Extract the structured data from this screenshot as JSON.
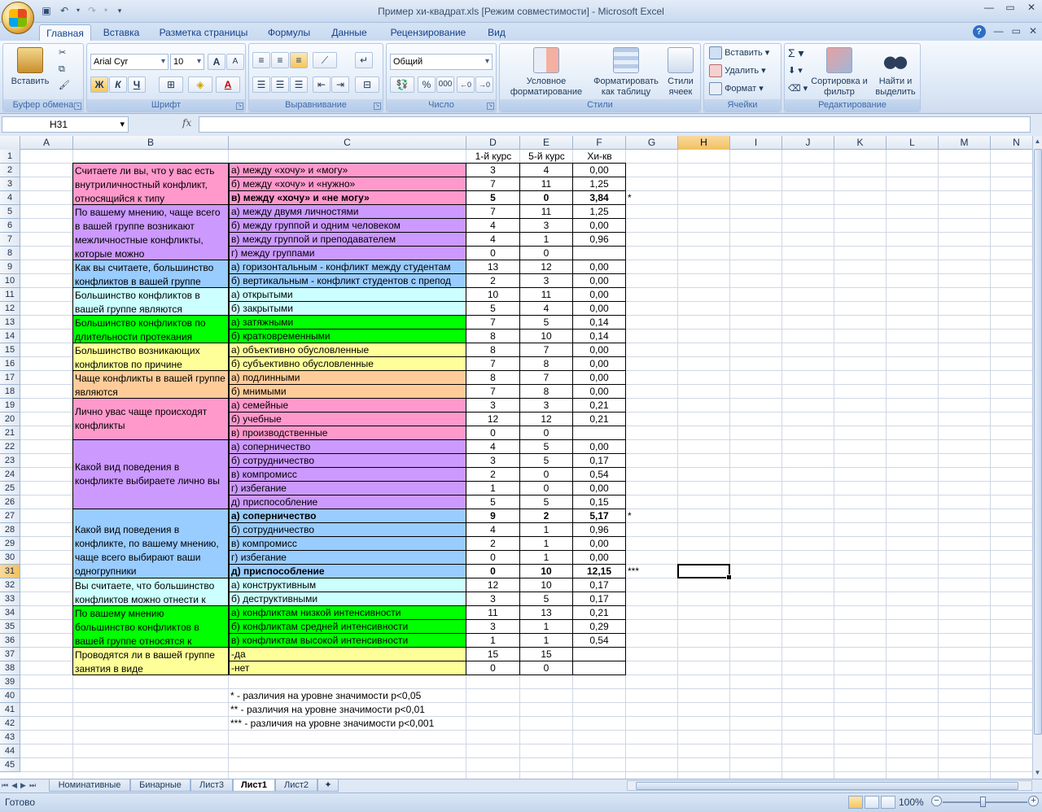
{
  "window": {
    "title": "Пример хи-квадрат.xls  [Режим совместимости] - Microsoft Excel"
  },
  "ribbon": {
    "tabs": [
      "Главная",
      "Вставка",
      "Разметка страницы",
      "Формулы",
      "Данные",
      "Рецензирование",
      "Вид"
    ],
    "active_tab": "Главная",
    "clipboard": {
      "label": "Буфер обмена",
      "paste": "Вставить"
    },
    "font": {
      "label": "Шрифт",
      "font_name": "Arial Cyr",
      "font_size": "10",
      "bold": "Ж",
      "italic": "К",
      "underline": "Ч",
      "grow": "A",
      "shrink": "A",
      "color": "A"
    },
    "alignment": {
      "label": "Выравнивание"
    },
    "number": {
      "label": "Число",
      "format": "Общий",
      "percent": "%",
      "thousands": "000"
    },
    "styles": {
      "label": "Стили",
      "conditional": "Условное форматирование",
      "as_table": "Форматировать как таблицу",
      "cell_styles": "Стили ячеек"
    },
    "cells": {
      "label": "Ячейки",
      "insert": "Вставить",
      "delete": "Удалить",
      "format": "Формат"
    },
    "editing": {
      "label": "Редактирование",
      "sort": "Сортировка и фильтр",
      "find": "Найти и выделить"
    }
  },
  "formula_bar": {
    "name_box": "H31",
    "fx": "fx",
    "formula": ""
  },
  "columns": [
    "A",
    "B",
    "C",
    "D",
    "E",
    "F",
    "G",
    "H",
    "I",
    "J",
    "K",
    "L",
    "M",
    "N"
  ],
  "rows": [
    "1",
    "2",
    "3",
    "4",
    "5",
    "6",
    "7",
    "8",
    "9",
    "10",
    "11",
    "12",
    "13",
    "14",
    "15",
    "16",
    "17",
    "18",
    "19",
    "20",
    "21",
    "22",
    "23",
    "24",
    "25",
    "26",
    "27",
    "28",
    "29",
    "30",
    "31",
    "32",
    "33",
    "34",
    "35",
    "36",
    "37",
    "38",
    "39",
    "40",
    "41",
    "42",
    "43",
    "44",
    "45"
  ],
  "selected_cell": {
    "col": "H",
    "row": "31"
  },
  "headers": {
    "d": "1-й курс",
    "e": "5-й курс",
    "f": "Хи-кв"
  },
  "questions": [
    {
      "text": "Считаете ли вы, что у вас есть внутриличностный конфликт, относящийся к типу",
      "color": "#ff99cc"
    },
    {
      "text": "По вашему мнению, чаще всего в вашей группе возникают межличностные конфликты, которые можно",
      "color": "#cc99ff"
    },
    {
      "text": "Как вы считаете, большинство конфликтов в вашей группе",
      "color": "#99ccff"
    },
    {
      "text": "Большинство конфликтов в вашей группе являются",
      "color": "#ccffff"
    },
    {
      "text": "Большинство конфликтов по длительности протекания",
      "color": "#00ff00"
    },
    {
      "text": "Большинство возникающих конфликтов по причине",
      "color": "#ffff99"
    },
    {
      "text": "Чаще конфликты в вашей группе являются",
      "color": "#ffcc99"
    },
    {
      "text": "Лично увас чаще происходят конфликты",
      "color": "#ff99cc"
    },
    {
      "text": "Какой вид поведения в конфликте выбираете лично вы",
      "color": "#cc99ff"
    },
    {
      "text": "Какой вид поведения в конфликте, по вашему мнению, чаще всего выбирают ваши одногрупники",
      "color": "#99ccff"
    },
    {
      "text": "Вы считаете, что большинство конфликтов можно отнести к",
      "color": "#ccffff"
    },
    {
      "text": "По вашему мнению большинство конфликтов в вашей группе относятся к",
      "color": "#00ff00"
    },
    {
      "text": "Проводятся ли в вашей группе занятия в виде",
      "color": "#ffff99"
    }
  ],
  "table_rows": [
    {
      "c": "а) между «хочу» и «могу»",
      "d": "3",
      "e": "4",
      "f": "0,00",
      "g": "",
      "bold": false
    },
    {
      "c": "б) между «хочу» и «нужно»",
      "d": "7",
      "e": "11",
      "f": "1,25",
      "g": "",
      "bold": false
    },
    {
      "c": "в) между «хочу» и «не могу»",
      "d": "5",
      "e": "0",
      "f": "3,84",
      "g": "*",
      "bold": true
    },
    {
      "c": "а) между двумя личностями",
      "d": "7",
      "e": "11",
      "f": "1,25",
      "g": "",
      "bold": false
    },
    {
      "c": "б) между группой и одним человеком",
      "d": "4",
      "e": "3",
      "f": "0,00",
      "g": "",
      "bold": false
    },
    {
      "c": "в) между группой и преподавателем",
      "d": "4",
      "e": "1",
      "f": "0,96",
      "g": "",
      "bold": false
    },
    {
      "c": "г) между группами",
      "d": "0",
      "e": "0",
      "f": "",
      "g": "",
      "bold": false
    },
    {
      "c": "а) горизонтальным - конфликт между студентам",
      "d": "13",
      "e": "12",
      "f": "0,00",
      "g": "",
      "bold": false
    },
    {
      "c": "б) вертикальным - конфликт студентов с препод",
      "d": "2",
      "e": "3",
      "f": "0,00",
      "g": "",
      "bold": false
    },
    {
      "c": "а) открытыми",
      "d": "10",
      "e": "11",
      "f": "0,00",
      "g": "",
      "bold": false
    },
    {
      "c": "б) закрытыми",
      "d": "5",
      "e": "4",
      "f": "0,00",
      "g": "",
      "bold": false
    },
    {
      "c": "а) затяжными",
      "d": "7",
      "e": "5",
      "f": "0,14",
      "g": "",
      "bold": false
    },
    {
      "c": "б) кратковременными",
      "d": "8",
      "e": "10",
      "f": "0,14",
      "g": "",
      "bold": false
    },
    {
      "c": "а) объективно обусловленные",
      "d": "8",
      "e": "7",
      "f": "0,00",
      "g": "",
      "bold": false
    },
    {
      "c": "б) субъективно обусловленные",
      "d": "7",
      "e": "8",
      "f": "0,00",
      "g": "",
      "bold": false
    },
    {
      "c": "а) подлинными",
      "d": "8",
      "e": "7",
      "f": "0,00",
      "g": "",
      "bold": false
    },
    {
      "c": "б) мнимыми",
      "d": "7",
      "e": "8",
      "f": "0,00",
      "g": "",
      "bold": false
    },
    {
      "c": "а) семейные",
      "d": "3",
      "e": "3",
      "f": "0,21",
      "g": "",
      "bold": false
    },
    {
      "c": "б) учебные",
      "d": "12",
      "e": "12",
      "f": "0,21",
      "g": "",
      "bold": false
    },
    {
      "c": "в) производственные",
      "d": "0",
      "e": "0",
      "f": "",
      "g": "",
      "bold": false
    },
    {
      "c": "а) соперничество",
      "d": "4",
      "e": "5",
      "f": "0,00",
      "g": "",
      "bold": false
    },
    {
      "c": "б) сотрудничество",
      "d": "3",
      "e": "5",
      "f": "0,17",
      "g": "",
      "bold": false
    },
    {
      "c": "в) компромисс",
      "d": "2",
      "e": "0",
      "f": "0,54",
      "g": "",
      "bold": false
    },
    {
      "c": "г) избегание",
      "d": "1",
      "e": "0",
      "f": "0,00",
      "g": "",
      "bold": false
    },
    {
      "c": "д) приспособление",
      "d": "5",
      "e": "5",
      "f": "0,15",
      "g": "",
      "bold": false
    },
    {
      "c": "а) соперничество",
      "d": "9",
      "e": "2",
      "f": "5,17",
      "g": "*",
      "bold": true
    },
    {
      "c": "б) сотрудничество",
      "d": "4",
      "e": "1",
      "f": "0,96",
      "g": "",
      "bold": false
    },
    {
      "c": "в) компромисс",
      "d": "2",
      "e": "1",
      "f": "0,00",
      "g": "",
      "bold": false
    },
    {
      "c": "г) избегание",
      "d": "0",
      "e": "1",
      "f": "0,00",
      "g": "",
      "bold": false
    },
    {
      "c": "д) приспособление",
      "d": "0",
      "e": "10",
      "f": "12,15",
      "g": "***",
      "bold": true
    },
    {
      "c": "а) конструктивным",
      "d": "12",
      "e": "10",
      "f": "0,17",
      "g": "",
      "bold": false
    },
    {
      "c": "б) деструктивными",
      "d": "3",
      "e": "5",
      "f": "0,17",
      "g": "",
      "bold": false
    },
    {
      "c": "а) конфликтам низкой интенсивности",
      "d": "11",
      "e": "13",
      "f": "0,21",
      "g": "",
      "bold": false
    },
    {
      "c": "б) конфликтам средней интенсивности",
      "d": "3",
      "e": "1",
      "f": "0,29",
      "g": "",
      "bold": false
    },
    {
      "c": "в) конфликтам высокой интенсивности",
      "d": "1",
      "e": "1",
      "f": "0,54",
      "g": "",
      "bold": false
    },
    {
      "c": "-да",
      "d": "15",
      "e": "15",
      "f": "",
      "g": "",
      "bold": false
    },
    {
      "c": "-нет",
      "d": "0",
      "e": "0",
      "f": "",
      "g": "",
      "bold": false
    }
  ],
  "notes": [
    "* - различия на уровне значимости p<0,05",
    "** - различия на уровне значимости p<0,01",
    "*** - различия на уровне значимости p<0,001"
  ],
  "sheets": [
    "Номинативные",
    "Бинарные",
    "Лист3",
    "Лист1",
    "Лист2"
  ],
  "active_sheet": "Лист1",
  "status": {
    "ready": "Готово",
    "zoom": "100%"
  }
}
